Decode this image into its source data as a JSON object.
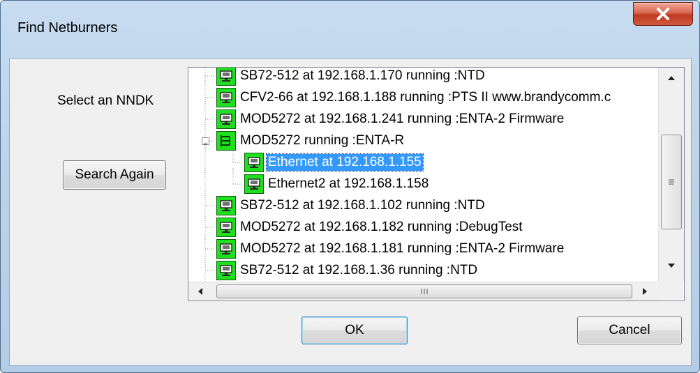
{
  "window": {
    "title": "Find Netburners"
  },
  "labels": {
    "select": "Select an NNDK"
  },
  "buttons": {
    "search_again": "Search Again",
    "ok": "OK",
    "cancel": "Cancel"
  },
  "tree": {
    "items": [
      {
        "label": "SB72-512  at 192.168.1.170 running :NTD",
        "icon": "network-device-icon"
      },
      {
        "label": "CFV2-66  at 192.168.1.188 running :PTS II www.brandycomm.c",
        "icon": "network-device-icon"
      },
      {
        "label": "MOD5272  at 192.168.1.241 running :ENTA-2 Firmware",
        "icon": "network-device-icon"
      },
      {
        "label": "MOD5272 running :ENTA-R",
        "icon": "multi-interface-icon",
        "expanded": true,
        "children": [
          {
            "label": "Ethernet at 192.168.1.155",
            "icon": "network-device-icon",
            "selected": true
          },
          {
            "label": "Ethernet2 at 192.168.1.158",
            "icon": "network-device-icon"
          }
        ]
      },
      {
        "label": "SB72-512  at 192.168.1.102 running :NTD",
        "icon": "network-device-icon"
      },
      {
        "label": "MOD5272  at 192.168.1.182 running :DebugTest",
        "icon": "network-device-icon"
      },
      {
        "label": "MOD5272  at 192.168.1.181 running :ENTA-2 Firmware",
        "icon": "network-device-icon"
      },
      {
        "label": "SB72-512  at 192.168.1.36 running :NTD",
        "icon": "network-device-icon"
      }
    ]
  },
  "colors": {
    "node_icon": "#1fe01f",
    "selection": "#3399ff",
    "close_button": "#c7432a"
  }
}
